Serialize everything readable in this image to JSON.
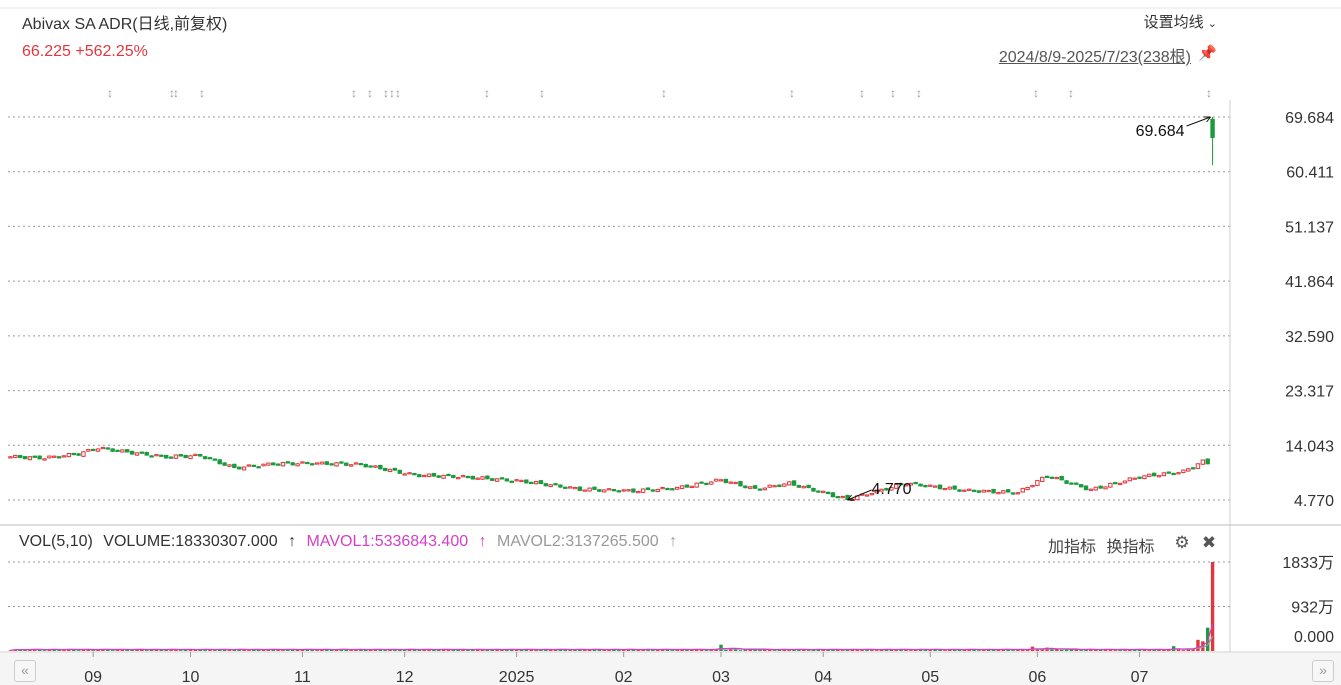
{
  "header": {
    "title": "Abivax SA ADR(日线,前复权)",
    "price_line": "66.225 +562.25%",
    "ma_setting": "设置均线",
    "range": "2024/8/9-2025/7/23(238根)"
  },
  "volume_panel": {
    "vol_label": "VOL(5,10)",
    "volume_label": "VOLUME:18330307.000",
    "mavol1_label": "MAVOL1:5336843.400",
    "mavol2_label": "MAVOL2:3137265.500",
    "add_indicator": "加指标",
    "change_indicator": "换指标"
  },
  "icons": {
    "ma_dropdown": "chevron-down-icon",
    "pin": "pin-icon",
    "settings": "gear-icon",
    "close": "close-icon",
    "scroll_left": "double-chevron-left-icon",
    "scroll_right": "double-chevron-right-icon"
  },
  "colors": {
    "up": "#e0383e",
    "down": "#1a9a3c",
    "mavol1": "#d43fc9",
    "mavol2": "#9a9a9a",
    "grid": "#999999"
  },
  "chart_data": [
    {
      "type": "candlestick",
      "ylim": [
        4.77,
        69.684
      ],
      "y_ticks": [
        "69.684",
        "60.411",
        "51.137",
        "41.864",
        "32.590",
        "23.317",
        "14.043",
        "4.770"
      ],
      "x_ticks": [
        "09",
        "10",
        "11",
        "12",
        "2025",
        "02",
        "03",
        "04",
        "05",
        "06",
        "07"
      ],
      "annotations": [
        {
          "text": "69.684",
          "date": "2025-07-22",
          "value": 69.684
        },
        {
          "text": "4.770",
          "date": "2025-04-08",
          "value": 4.77
        }
      ],
      "last": {
        "close": 66.225,
        "change_pct": "+562.25%"
      },
      "close_series": [
        {
          "d": "2024-08-09",
          "v": 12.1
        },
        {
          "d": "2024-08-20",
          "v": 11.9
        },
        {
          "d": "2024-08-29",
          "v": 12.6
        },
        {
          "d": "2024-09-04",
          "v": 13.6
        },
        {
          "d": "2024-09-12",
          "v": 12.9
        },
        {
          "d": "2024-09-24",
          "v": 12.1
        },
        {
          "d": "2024-10-03",
          "v": 12.3
        },
        {
          "d": "2024-10-14",
          "v": 10.2
        },
        {
          "d": "2024-10-24",
          "v": 10.9
        },
        {
          "d": "2024-11-05",
          "v": 11.0
        },
        {
          "d": "2024-11-19",
          "v": 10.8
        },
        {
          "d": "2024-12-04",
          "v": 9.0
        },
        {
          "d": "2024-12-18",
          "v": 8.7
        },
        {
          "d": "2025-01-06",
          "v": 7.9
        },
        {
          "d": "2025-01-21",
          "v": 6.6
        },
        {
          "d": "2025-02-05",
          "v": 6.3
        },
        {
          "d": "2025-02-18",
          "v": 6.8
        },
        {
          "d": "2025-03-03",
          "v": 8.2
        },
        {
          "d": "2025-03-12",
          "v": 6.6
        },
        {
          "d": "2025-03-21",
          "v": 7.6
        },
        {
          "d": "2025-04-08",
          "v": 4.9
        },
        {
          "d": "2025-04-24",
          "v": 7.6
        },
        {
          "d": "2025-05-12",
          "v": 6.4
        },
        {
          "d": "2025-05-27",
          "v": 6.0
        },
        {
          "d": "2025-06-04",
          "v": 8.9
        },
        {
          "d": "2025-06-17",
          "v": 6.5
        },
        {
          "d": "2025-07-01",
          "v": 8.7
        },
        {
          "d": "2025-07-14",
          "v": 9.6
        },
        {
          "d": "2025-07-18",
          "v": 11.3
        },
        {
          "d": "2025-07-21",
          "v": 11.0
        },
        {
          "d": "2025-07-22",
          "v": 66.225
        }
      ]
    },
    {
      "type": "bar",
      "title": "VOL(5,10)",
      "y_ticks": [
        "1833万",
        "932万",
        "0.000"
      ],
      "ylim": [
        0,
        18330307
      ],
      "volume_series": [
        {
          "d": "2025-03-03",
          "v": 1300000
        },
        {
          "d": "2025-05-30",
          "v": 900000
        },
        {
          "d": "2025-06-04",
          "v": 700000
        },
        {
          "d": "2025-07-10",
          "v": 1000000
        },
        {
          "d": "2025-07-17",
          "v": 2300000
        },
        {
          "d": "2025-07-18",
          "v": 2000000
        },
        {
          "d": "2025-07-21",
          "v": 4800000
        },
        {
          "d": "2025-07-22",
          "v": 18330307
        }
      ],
      "mavol1": 5336843.4,
      "mavol2": 3137265.5
    }
  ]
}
